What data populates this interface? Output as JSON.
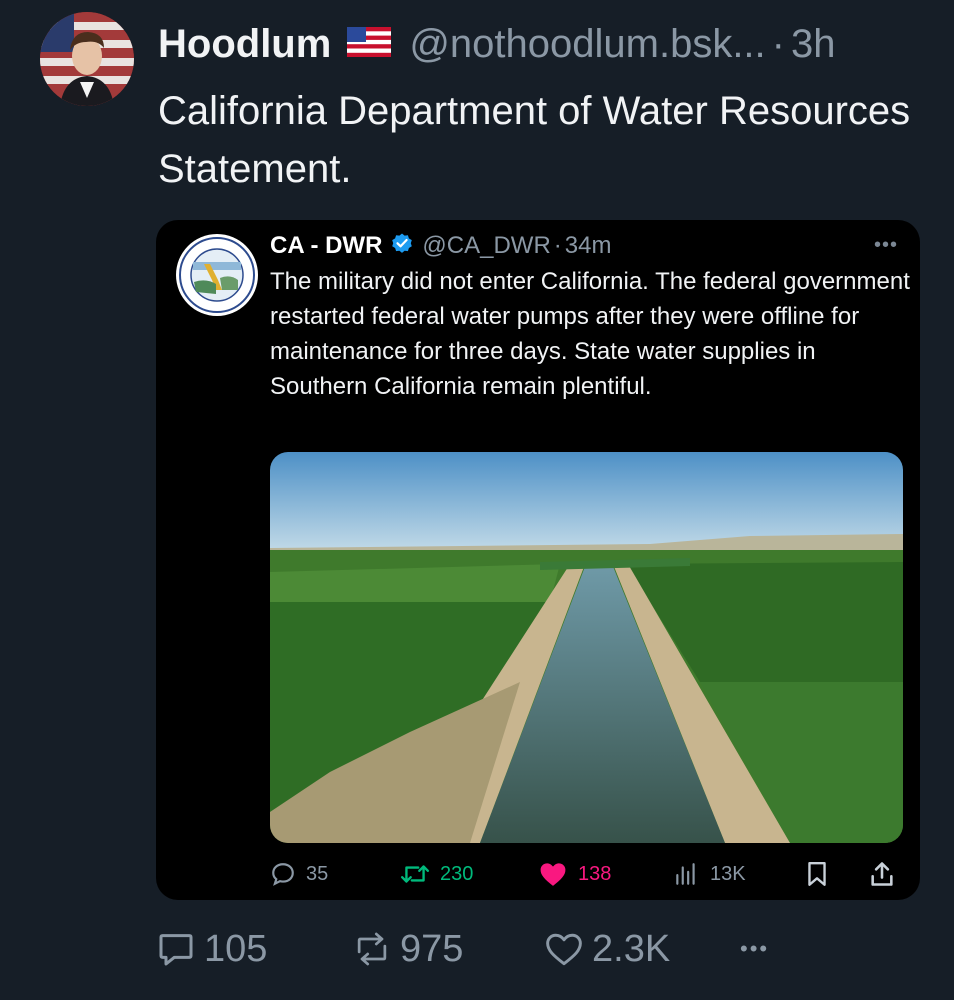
{
  "post": {
    "author": {
      "display_name": "Hoodlum",
      "flag_icon": "us-flag-icon",
      "handle": "@nothoodlum.bsk...",
      "separator": "·",
      "time": "3h"
    },
    "text": "California Department of Water Resources Statement.",
    "actions": {
      "replies": "105",
      "reposts": "975",
      "likes": "2.3K",
      "more": "•••"
    }
  },
  "quoted": {
    "author": {
      "display_name": "CA - DWR",
      "verified_icon": "verified-badge-icon",
      "handle": "@CA_DWR",
      "separator": "·",
      "time": "34m"
    },
    "more": "•••",
    "text": "The military did not enter California. The federal government restarted federal water pumps after they were offline for maintenance for three days. State water supplies in Southern California remain plentiful.",
    "media_alt": "Aerial view of a canal between farm fields",
    "actions": {
      "replies": "35",
      "reposts": "230",
      "likes": "138",
      "views": "13K"
    }
  },
  "colors": {
    "background": "#161e27",
    "quote_background": "#000000",
    "secondary_text": "#8b98a5",
    "repost_green": "#00ba7c",
    "like_pink": "#f91880",
    "verified_blue": "#1d9bf0"
  }
}
